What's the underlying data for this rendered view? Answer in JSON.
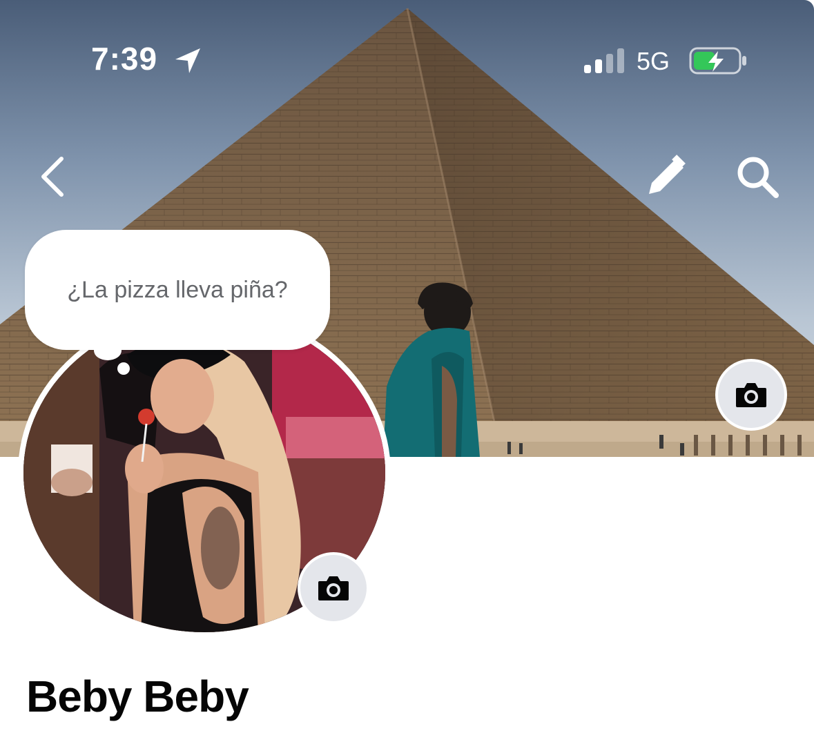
{
  "status_bar": {
    "time": "7:39",
    "network": "5G",
    "icons": [
      "location-arrow-icon",
      "cellular-signal-icon",
      "battery-charging-icon"
    ],
    "battery_color": "#34c759"
  },
  "nav": {
    "back_icon": "chevron-left-icon",
    "edit_icon": "pencil-icon",
    "search_icon": "search-icon"
  },
  "cover": {
    "camera_icon": "camera-icon"
  },
  "note": {
    "text": "¿La pizza lleva piña?"
  },
  "avatar": {
    "camera_icon": "camera-icon"
  },
  "profile": {
    "name": "Beby Beby"
  }
}
